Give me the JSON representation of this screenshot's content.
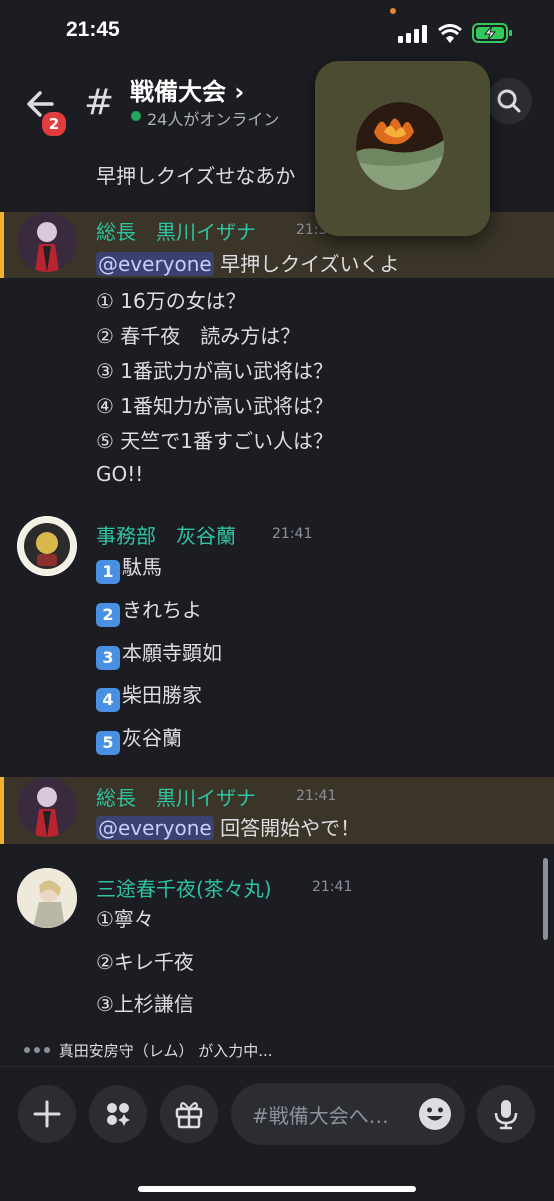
{
  "status_bar": {
    "time": "21:45"
  },
  "header": {
    "back_badge": "2",
    "channel_name": "戦備大会 ›",
    "online": "24人がオンライン"
  },
  "messages": [
    {
      "id": "prev",
      "text": "早押しクイズせなあか"
    },
    {
      "id": "m1",
      "author": "総長　黒川イザナ",
      "time": "21:39",
      "highlighted": true,
      "mention": "@everyone",
      "first_line": "早押しクイズいくよ",
      "lines": [
        "① 16万の女は？",
        "② 春千夜　読み方は？",
        "③ 1番武力が高い武将は？",
        "④ 1番知力が高い武将は？",
        "⑤ 天竺で1番すごい人は？",
        "GO!!"
      ]
    },
    {
      "id": "m2",
      "author": "事務部　灰谷蘭",
      "time": "21:41",
      "lines": [
        {
          "key": "1",
          "text": "駄馬"
        },
        {
          "key": "2",
          "text": "きれちよ"
        },
        {
          "key": "3",
          "text": "本願寺顕如"
        },
        {
          "key": "4",
          "text": "柴田勝家"
        },
        {
          "key": "5",
          "text": "灰谷蘭"
        }
      ]
    },
    {
      "id": "m3",
      "author": "総長　黒川イザナ",
      "time": "21:41",
      "highlighted": true,
      "mention": "@everyone",
      "first_line": "回答開始やで！"
    },
    {
      "id": "m4",
      "author": "三途春千夜(茶々丸)",
      "time": "21:41",
      "lines": [
        "①寧々",
        "②キレ千夜",
        "③上杉謙信"
      ]
    }
  ],
  "typing": {
    "text": "真田安房守（レム） が入力中..."
  },
  "composer": {
    "placeholder": "#戦備大会へ…"
  },
  "icons": [
    "back-arrow-icon",
    "hash-icon",
    "search-icon",
    "plus-icon",
    "apps-icon",
    "gift-icon",
    "emoji-icon",
    "mic-icon",
    "signal-icon",
    "wifi-icon",
    "battery-charging-icon"
  ],
  "colors": {
    "background": "#1c1d22",
    "username": "#2ec4a0",
    "highlight": "#3a3528",
    "highlight_bar": "#f0b232",
    "mention_bg": "#3c4270",
    "online": "#23a55a",
    "badge": "#e23c3c"
  }
}
